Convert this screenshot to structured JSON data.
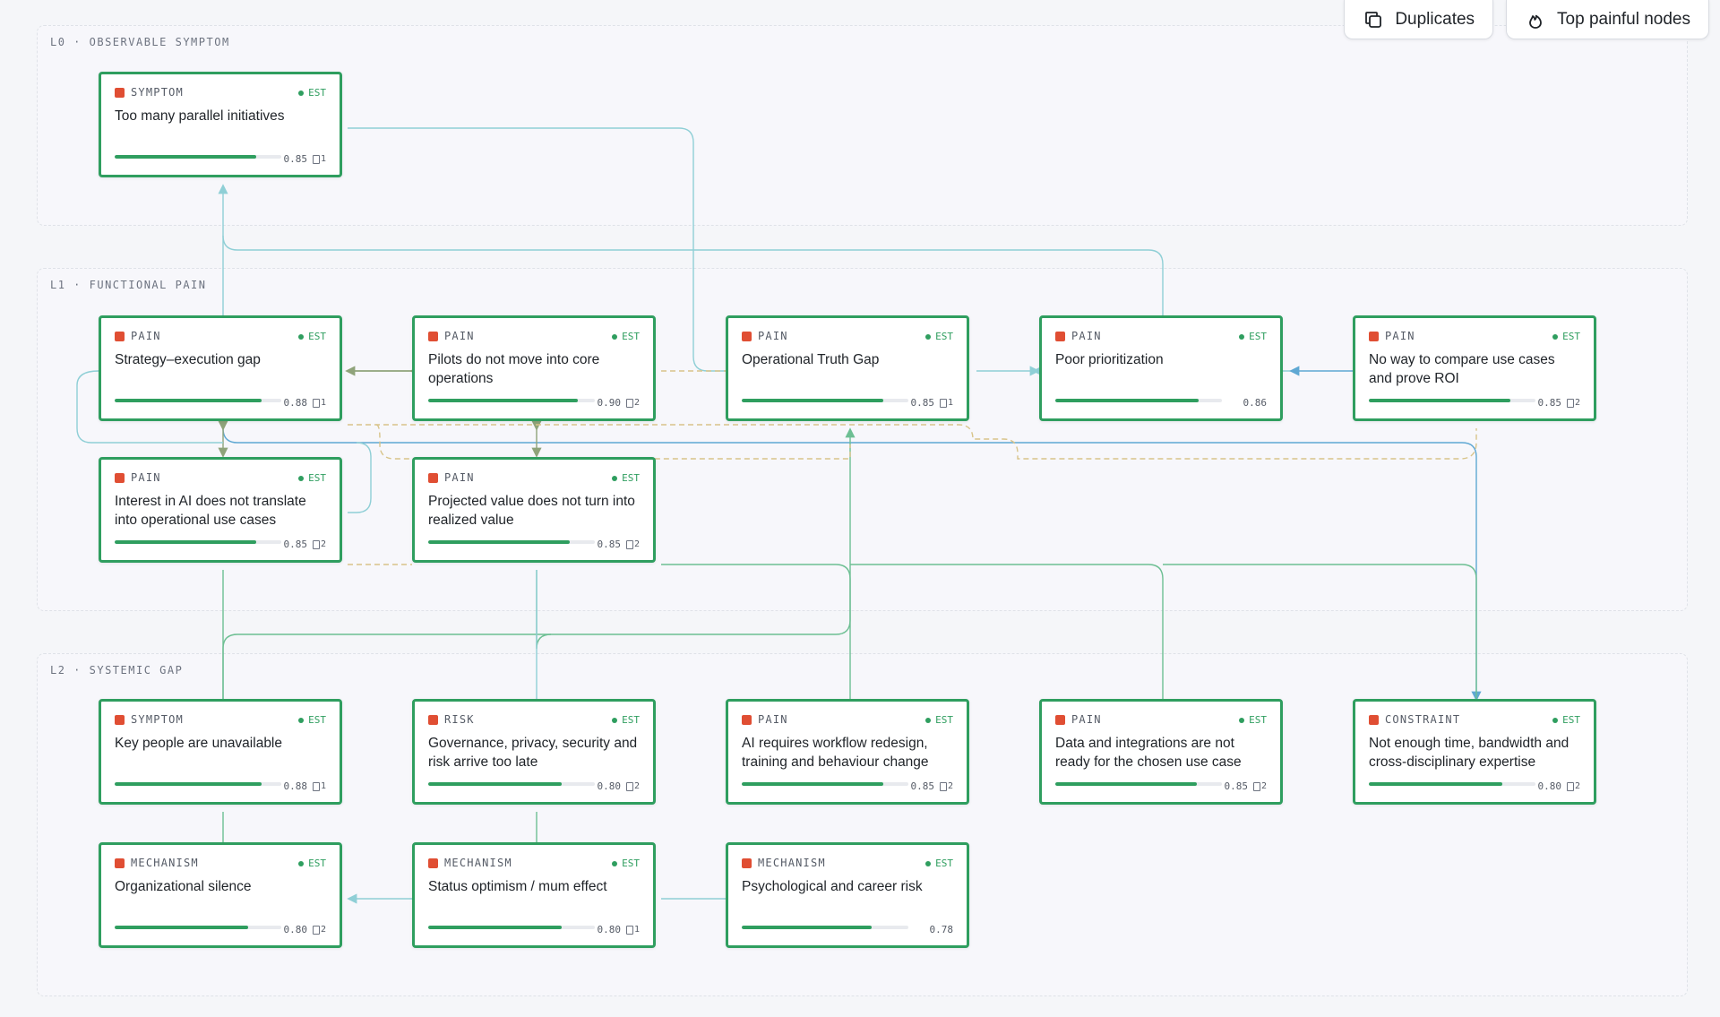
{
  "toolbar": {
    "duplicates_label": "Duplicates",
    "top_painful_label": "Top painful nodes"
  },
  "layers": [
    {
      "id": "l0",
      "label": "L0 · OBSERVABLE SYMPTOM"
    },
    {
      "id": "l1",
      "label": "L1 · FUNCTIONAL PAIN"
    },
    {
      "id": "l2",
      "label": "L2 · SYSTEMIC GAP"
    }
  ],
  "colors": {
    "node_border": "#2f9e5f",
    "type_marker": "#e04e33",
    "edge_teal": "#8fcfd6",
    "edge_blue": "#5fa8d3",
    "edge_green": "#6dbf93",
    "edge_dashed": "#d8c48a",
    "edge_olive": "#8fa37a"
  },
  "nodes": [
    {
      "id": "too-many-parallel-initiatives",
      "type": "SYMPTOM",
      "badge": "EST",
      "title": "Too many parallel initiatives",
      "score": 0.85,
      "score_label": "0.85",
      "doc_count": "1"
    },
    {
      "id": "strategy-execution-gap",
      "type": "PAIN",
      "badge": "EST",
      "title": "Strategy–execution gap",
      "score": 0.88,
      "score_label": "0.88",
      "doc_count": "1"
    },
    {
      "id": "pilots-do-not-move",
      "type": "PAIN",
      "badge": "EST",
      "title": "Pilots do not move into core operations",
      "score": 0.9,
      "score_label": "0.90",
      "doc_count": "2"
    },
    {
      "id": "operational-truth-gap",
      "type": "PAIN",
      "badge": "EST",
      "title": "Operational Truth Gap",
      "score": 0.85,
      "score_label": "0.85",
      "doc_count": "1"
    },
    {
      "id": "poor-prioritization",
      "type": "PAIN",
      "badge": "EST",
      "title": "Poor prioritization",
      "score": 0.86,
      "score_label": "0.86",
      "doc_count": ""
    },
    {
      "id": "no-way-to-compare",
      "type": "PAIN",
      "badge": "EST",
      "title": "No way to compare use cases and prove ROI",
      "score": 0.85,
      "score_label": "0.85",
      "doc_count": "2"
    },
    {
      "id": "interest-in-ai",
      "type": "PAIN",
      "badge": "EST",
      "title": "Interest in AI does not translate into operational use cases",
      "score": 0.85,
      "score_label": "0.85",
      "doc_count": "2"
    },
    {
      "id": "projected-value",
      "type": "PAIN",
      "badge": "EST",
      "title": "Projected value does not turn into realized value",
      "score": 0.85,
      "score_label": "0.85",
      "doc_count": "2"
    },
    {
      "id": "key-people-unavailable",
      "type": "SYMPTOM",
      "badge": "EST",
      "title": "Key people are unavailable",
      "score": 0.88,
      "score_label": "0.88",
      "doc_count": "1"
    },
    {
      "id": "governance-privacy",
      "type": "RISK",
      "badge": "EST",
      "title": "Governance, privacy, security and risk arrive too late",
      "score": 0.8,
      "score_label": "0.80",
      "doc_count": "2"
    },
    {
      "id": "ai-requires-workflow",
      "type": "PAIN",
      "badge": "EST",
      "title": "AI requires workflow redesign, training and behaviour change",
      "score": 0.85,
      "score_label": "0.85",
      "doc_count": "2"
    },
    {
      "id": "data-integrations",
      "type": "PAIN",
      "badge": "EST",
      "title": "Data and integrations are not ready for the chosen use case",
      "score": 0.85,
      "score_label": "0.85",
      "doc_count": "2"
    },
    {
      "id": "not-enough-time",
      "type": "CONSTRAINT",
      "badge": "EST",
      "title": "Not enough time, bandwidth and cross-disciplinary expertise",
      "score": 0.8,
      "score_label": "0.80",
      "doc_count": "2"
    },
    {
      "id": "organizational-silence",
      "type": "MECHANISM",
      "badge": "EST",
      "title": "Organizational silence",
      "score": 0.8,
      "score_label": "0.80",
      "doc_count": "2"
    },
    {
      "id": "status-optimism",
      "type": "MECHANISM",
      "badge": "EST",
      "title": "Status optimism / mum effect",
      "score": 0.8,
      "score_label": "0.80",
      "doc_count": "1"
    },
    {
      "id": "psychological-career-risk",
      "type": "MECHANISM",
      "badge": "EST",
      "title": "Psychological and career risk",
      "score": 0.78,
      "score_label": "0.78",
      "doc_count": ""
    }
  ]
}
